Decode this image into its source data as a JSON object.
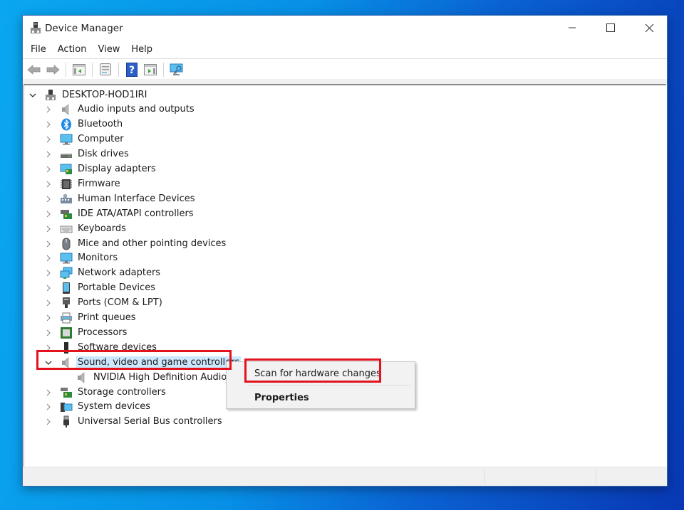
{
  "window": {
    "title": "Device Manager",
    "controls": {
      "minimize": "minimize",
      "maximize": "maximize",
      "close": "close"
    }
  },
  "menubar": [
    "File",
    "Action",
    "View",
    "Help"
  ],
  "toolbar": [
    {
      "name": "back-button",
      "icon": "arrow-left-icon"
    },
    {
      "name": "forward-button",
      "icon": "arrow-right-icon"
    },
    {
      "name": "show-hide-console-tree-button",
      "icon": "console-tree-icon"
    },
    {
      "name": "properties-button",
      "icon": "properties-icon"
    },
    {
      "name": "help-button",
      "icon": "help-icon"
    },
    {
      "name": "show-action-pane-button",
      "icon": "action-pane-icon"
    },
    {
      "name": "scan-hardware-button",
      "icon": "monitor-scan-icon"
    }
  ],
  "tree": {
    "root": {
      "label": "DESKTOP-HOD1IRI",
      "icon": "computer-root-icon",
      "expanded": true
    },
    "categories": [
      {
        "label": "Audio inputs and outputs",
        "icon": "speaker-icon"
      },
      {
        "label": "Bluetooth",
        "icon": "bluetooth-icon"
      },
      {
        "label": "Computer",
        "icon": "computer-icon"
      },
      {
        "label": "Disk drives",
        "icon": "disk-drive-icon"
      },
      {
        "label": "Display adapters",
        "icon": "display-adapter-icon"
      },
      {
        "label": "Firmware",
        "icon": "firmware-chip-icon"
      },
      {
        "label": "Human Interface Devices",
        "icon": "hid-icon"
      },
      {
        "label": "IDE ATA/ATAPI controllers",
        "icon": "ide-controller-icon"
      },
      {
        "label": "Keyboards",
        "icon": "keyboard-icon"
      },
      {
        "label": "Mice and other pointing devices",
        "icon": "mouse-icon"
      },
      {
        "label": "Monitors",
        "icon": "monitor-icon"
      },
      {
        "label": "Network adapters",
        "icon": "network-adapter-icon"
      },
      {
        "label": "Portable Devices",
        "icon": "portable-device-icon"
      },
      {
        "label": "Ports (COM & LPT)",
        "icon": "port-icon"
      },
      {
        "label": "Print queues",
        "icon": "printer-icon"
      },
      {
        "label": "Processors",
        "icon": "processor-icon"
      },
      {
        "label": "Software devices",
        "icon": "software-device-icon"
      },
      {
        "label": "Sound, video and game controllers",
        "icon": "speaker-icon",
        "expanded": true,
        "selected": true,
        "children": [
          {
            "label": "NVIDIA High Definition Audio",
            "icon": "speaker-icon"
          }
        ]
      },
      {
        "label": "Storage controllers",
        "icon": "storage-controller-icon"
      },
      {
        "label": "System devices",
        "icon": "system-devices-icon"
      },
      {
        "label": "Universal Serial Bus controllers",
        "icon": "usb-icon"
      }
    ]
  },
  "context_menu": {
    "items": [
      {
        "label": "Scan for hardware changes",
        "bold": false
      },
      {
        "label": "Properties",
        "bold": true
      }
    ]
  },
  "annotations": {
    "highlight_color": "#e3131d"
  },
  "colors": {
    "selection": "#cce8ff",
    "menu_bg": "#f2f2f2"
  }
}
